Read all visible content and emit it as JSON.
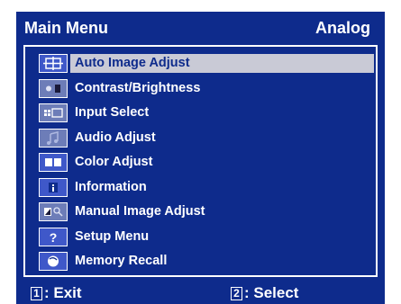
{
  "header": {
    "title": "Main Menu",
    "mode": "Analog"
  },
  "menu": {
    "items": [
      {
        "label": "Auto Image Adjust",
        "icon": "crosshair-icon",
        "selected": true
      },
      {
        "label": "Contrast/Brightness",
        "icon": "brightness-icon"
      },
      {
        "label": "Input Select",
        "icon": "input-source-icon"
      },
      {
        "label": "Audio Adjust",
        "icon": "audio-icon"
      },
      {
        "label": "Color Adjust",
        "icon": "color-bars-icon"
      },
      {
        "label": "Information",
        "icon": "info-icon"
      },
      {
        "label": "Manual Image Adjust",
        "icon": "tools-icon"
      },
      {
        "label": "Setup Menu",
        "icon": "question-icon"
      },
      {
        "label": "Memory Recall",
        "icon": "recall-icon"
      }
    ]
  },
  "footer": {
    "exit_key": "1",
    "exit_label": ": Exit",
    "select_key": "2",
    "select_label": ": Select"
  },
  "colors": {
    "background": "#0e2b8c",
    "highlight": "#c9cad6",
    "icon_tile": "#6d7db8",
    "text": "#ffffff"
  }
}
